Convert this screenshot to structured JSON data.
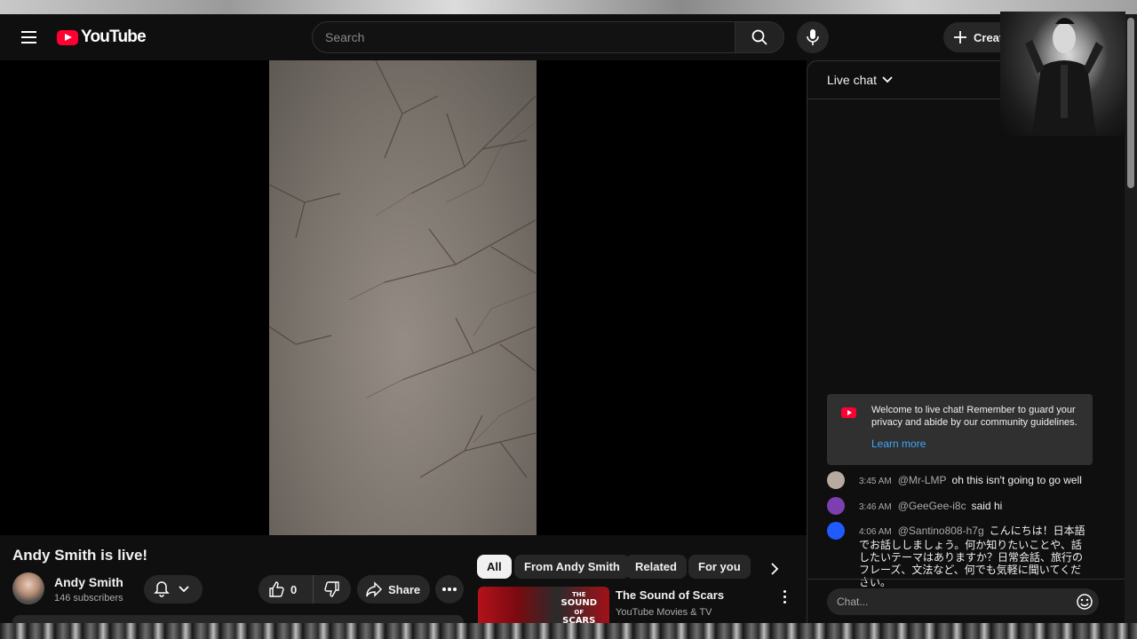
{
  "masthead": {
    "logo_text": "YouTube",
    "search_placeholder": "Search",
    "create_label": "Create"
  },
  "video": {
    "title": "Andy Smith is live!",
    "channel_name": "Andy Smith",
    "subscribers": "146 subscribers",
    "like_count": "0",
    "share_label": "Share"
  },
  "chips": {
    "items": [
      "All",
      "From Andy Smith",
      "Related",
      "For you"
    ]
  },
  "recommendation": {
    "title": "The Sound of Scars",
    "channel": "YouTube Movies & TV",
    "thumb_line1": "THE",
    "thumb_line2": "SOUND",
    "thumb_line3": "OF",
    "thumb_line4": "SCARS"
  },
  "chat": {
    "title": "Live chat",
    "welcome_text": "Welcome to live chat! Remember to guard your privacy and abide by our community guidelines.",
    "learn_more": "Learn more",
    "messages": [
      {
        "time": "3:45 AM",
        "author": "@Mr-LMP",
        "text": "oh this isn't going to go well",
        "avatar_color": "#b9aaa0"
      },
      {
        "time": "3:46 AM",
        "author": "@GeeGee-i8c",
        "text": "said hi",
        "avatar_color": "#7c3fb0"
      },
      {
        "time": "4:06 AM",
        "author": "@Santino808-h7g",
        "text": "こんにちは！日本語でお話ししましょう。何か知りたいことや、話したいテーマはありますか？日常会話、旅行のフレーズ、文法など、何でも気軽に聞いてください。",
        "avatar_color": "#1f5bff"
      }
    ],
    "input_placeholder": "Chat..."
  },
  "colors": {
    "brand_red": "#ff0033",
    "background": "#0f0f0f",
    "link_blue": "#3ea6ff"
  }
}
